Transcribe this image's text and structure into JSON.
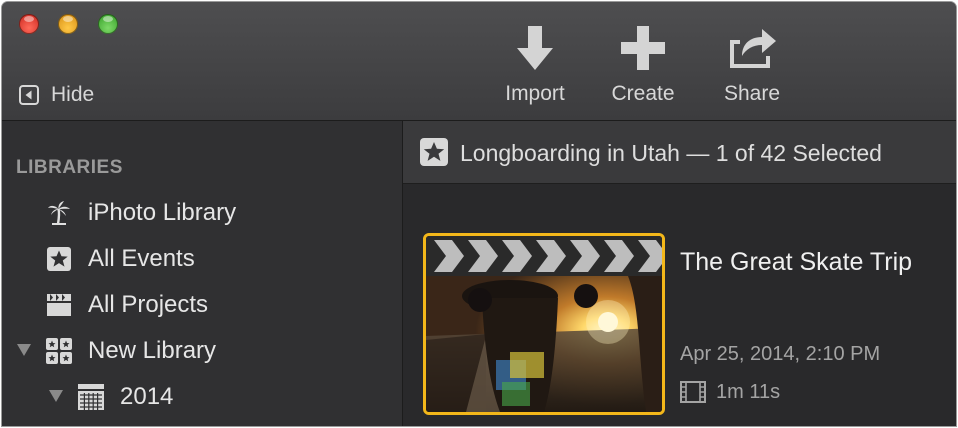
{
  "window": {
    "traffic_lights": [
      "close",
      "minimize",
      "zoom"
    ]
  },
  "toolbar": {
    "hide_label": "Hide",
    "import_label": "Import",
    "create_label": "Create",
    "share_label": "Share"
  },
  "sidebar": {
    "section_title": "LIBRARIES",
    "items": [
      {
        "label": "iPhoto Library",
        "icon": "palm-tree-icon"
      },
      {
        "label": "All Events",
        "icon": "star-icon"
      },
      {
        "label": "All Projects",
        "icon": "clapperboard-icon"
      },
      {
        "label": "New Library",
        "icon": "library-grid-icon",
        "expanded": true
      },
      {
        "label": "2014",
        "icon": "calendar-icon",
        "expanded": true
      }
    ]
  },
  "browser": {
    "header_title": "Longboarding in Utah — 1 of 42 Selected",
    "project": {
      "title": "The Great Skate Trip",
      "date": "Apr 25, 2014, 2:10 PM",
      "duration": "1m 11s",
      "selected": true
    }
  },
  "colors": {
    "selection_accent": "#f3b71a",
    "toolbar_bg": "#444446",
    "sidebar_bg": "#303032",
    "browser_bg": "#29292b"
  }
}
